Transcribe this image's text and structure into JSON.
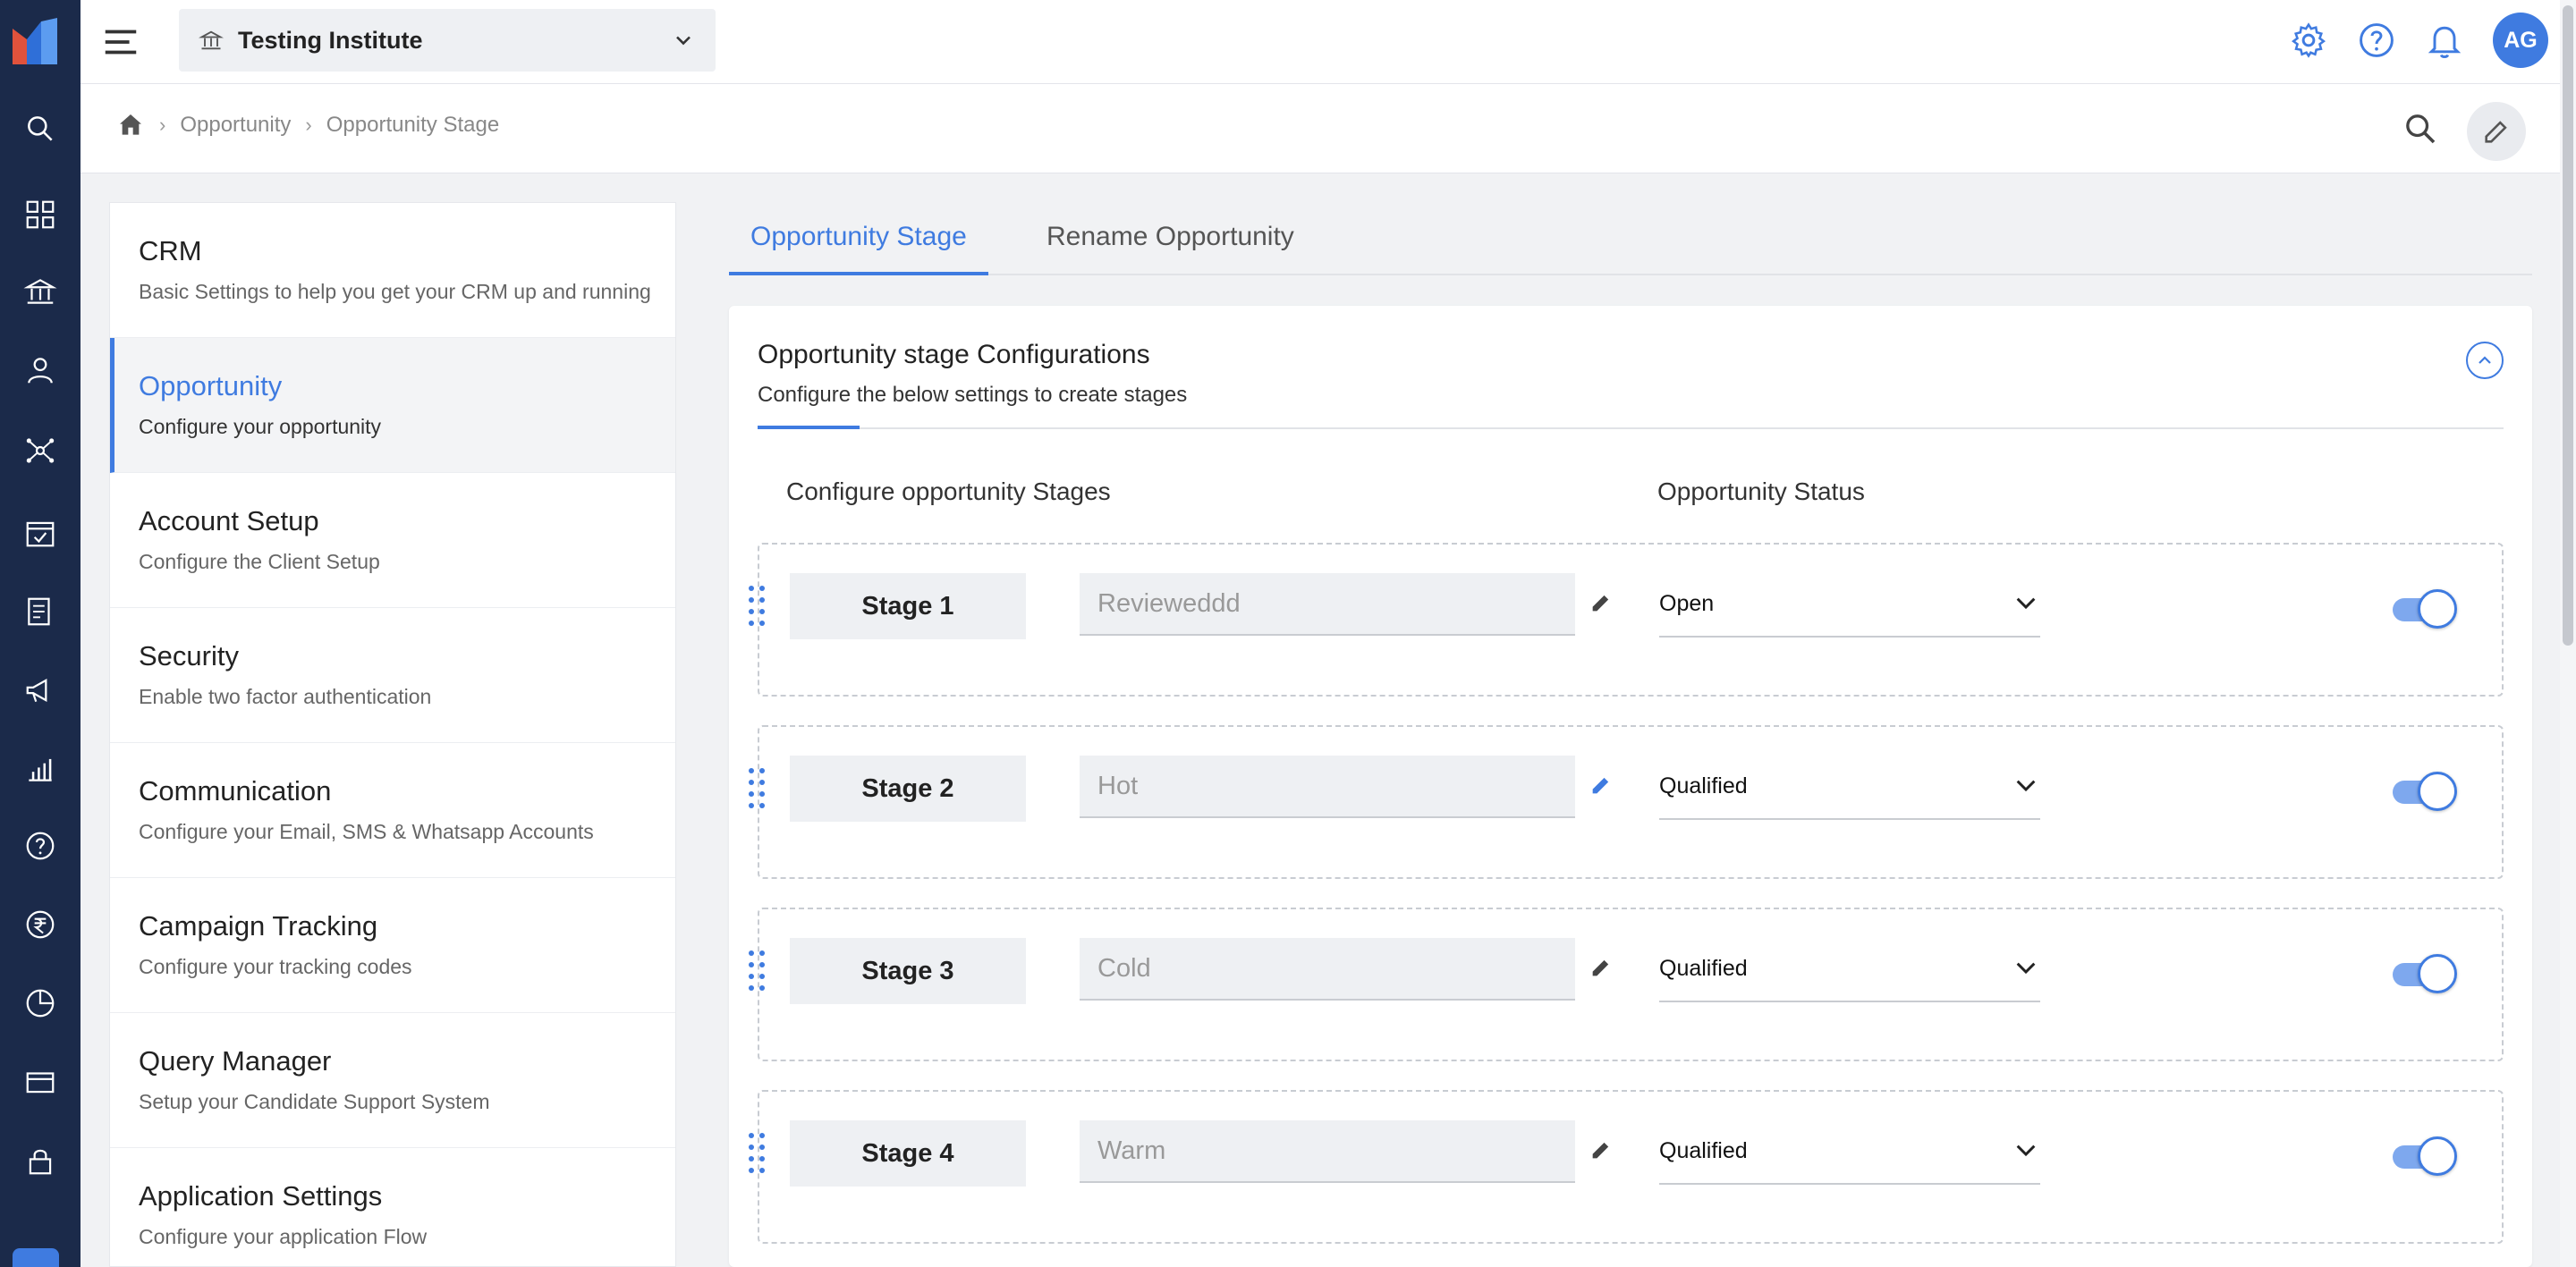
{
  "app": {
    "institute_name": "Testing Institute",
    "user_initials": "AG",
    "brand_color": "#3f7be0",
    "rail_color": "#1b2a4a"
  },
  "rail": {
    "icons": [
      "search-icon",
      "dashboard-icon",
      "institution-icon",
      "user-icon",
      "network-icon",
      "calendar-check-icon",
      "report-icon",
      "megaphone-icon",
      "analytics-icon",
      "help-icon",
      "rupee-icon",
      "pie-chart-icon",
      "card-icon",
      "lock-icon"
    ]
  },
  "breadcrumb": {
    "items": [
      "Opportunity",
      "Opportunity Stage"
    ]
  },
  "sidemenu": {
    "items": [
      {
        "title": "CRM",
        "desc": "Basic Settings to help you get your CRM up and running"
      },
      {
        "title": "Opportunity",
        "desc": "Configure your opportunity"
      },
      {
        "title": "Account Setup",
        "desc": "Configure the Client Setup"
      },
      {
        "title": "Security",
        "desc": "Enable two factor authentication"
      },
      {
        "title": "Communication",
        "desc": "Configure your Email, SMS & Whatsapp Accounts"
      },
      {
        "title": "Campaign Tracking",
        "desc": "Configure your tracking codes"
      },
      {
        "title": "Query Manager",
        "desc": "Setup your Candidate Support System"
      },
      {
        "title": "Application Settings",
        "desc": "Configure your application Flow"
      }
    ],
    "active_index": 1
  },
  "tabs": [
    {
      "label": "Opportunity Stage",
      "active": true
    },
    {
      "label": "Rename Opportunity",
      "active": false
    }
  ],
  "config": {
    "title": "Opportunity stage Configurations",
    "subtitle": "Configure the below settings to create stages",
    "col_stages": "Configure opportunity Stages",
    "col_status": "Opportunity Status",
    "stages": [
      {
        "label": "Stage 1",
        "name": "Revieweddd",
        "status": "Open",
        "enabled": true
      },
      {
        "label": "Stage 2",
        "name": "Hot",
        "status": "Qualified",
        "enabled": true
      },
      {
        "label": "Stage 3",
        "name": "Cold",
        "status": "Qualified",
        "enabled": true
      },
      {
        "label": "Stage 4",
        "name": "Warm",
        "status": "Qualified",
        "enabled": true
      }
    ]
  }
}
